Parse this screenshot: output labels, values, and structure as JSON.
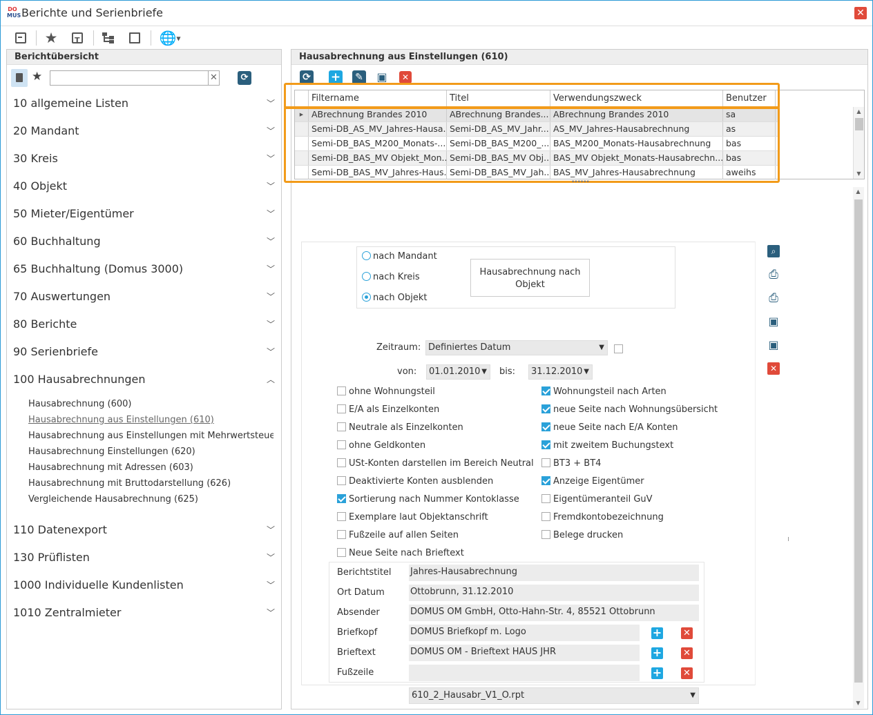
{
  "window": {
    "title": "Berichte und Serienbriefe",
    "logo_top": "DO",
    "logo_bottom": "MUS",
    "close_label": "✕"
  },
  "toolbar": {
    "icons": [
      "import-icon",
      "star-icon",
      "text-template-icon",
      "tree-icon",
      "chart-document-icon",
      "globe-icon"
    ]
  },
  "left": {
    "header": "Berichtübersicht",
    "search_placeholder": "",
    "search_clear": "✕",
    "categories": [
      {
        "label": "10 allgemeine Listen"
      },
      {
        "label": "20 Mandant"
      },
      {
        "label": "30 Kreis"
      },
      {
        "label": "40 Objekt"
      },
      {
        "label": "50 Mieter/Eigentümer"
      },
      {
        "label": "60 Buchhaltung"
      },
      {
        "label": "65 Buchhaltung (Domus 3000)"
      },
      {
        "label": "70 Auswertungen"
      },
      {
        "label": "80 Berichte"
      },
      {
        "label": "90 Serienbriefe"
      },
      {
        "label": "100 Hausabrechnungen"
      },
      {
        "label": "110 Datenexport"
      },
      {
        "label": "130 Prüflisten"
      },
      {
        "label": "1000 Individuelle Kundenlisten"
      },
      {
        "label": "1010 Zentralmieter"
      }
    ],
    "sub_items": [
      {
        "label": "Hausabrechnung (600)"
      },
      {
        "label": "Hausabrechnung aus Einstellungen (610)"
      },
      {
        "label": "Hausabrechnung aus Einstellungen mit Mehrwertsteuer (..."
      },
      {
        "label": "Hausabrechnung Einstellungen (620)"
      },
      {
        "label": "Hausabrechnung mit Adressen (603)"
      },
      {
        "label": "Hausabrechnung mit Bruttodarstellung (626)"
      },
      {
        "label": "Vergleichende Hausabrechnung (625)"
      }
    ]
  },
  "right": {
    "header": "Hausabrechnung aus Einstellungen (610)",
    "grid": {
      "columns": [
        "Filtername",
        "Titel",
        "Verwendungszweck",
        "Benutzer"
      ],
      "rows": [
        [
          "ABrechnung Brandes 2010",
          "ABrechnung Brandes...",
          "ABrechnung Brandes 2010",
          "sa"
        ],
        [
          "Semi-DB_AS_MV_Jahres-Hausa...",
          "Semi-DB_AS_MV_Jahr...",
          "AS_MV_Jahres-Hausabrechnung",
          "as"
        ],
        [
          "Semi-DB_BAS_M200_Monats-...",
          "Semi-DB_BAS_M200_...",
          "BAS_M200_Monats-Hausabrechnung",
          "bas"
        ],
        [
          "Semi-DB_BAS_MV Objekt_Mon...",
          "Semi-DB_BAS_MV Obj...",
          "BAS_MV Objekt_Monats-Hausabrechn...",
          "bas"
        ],
        [
          "Semi-DB_BAS_MV_Jahres-Haus...",
          "Semi-DB_BAS_MV_Jah...",
          "BAS_MV_Jahres-Hausabrechnung",
          "aweihs"
        ]
      ]
    },
    "form": {
      "radios": [
        {
          "label": "nach Mandant",
          "checked": false
        },
        {
          "label": "nach Kreis",
          "checked": false
        },
        {
          "label": "nach Objekt",
          "checked": true
        }
      ],
      "big_button": "Hausabrechnung nach Objekt",
      "zeitraum_label": "Zeitraum:",
      "zeitraum_value": "Definiertes Datum",
      "von_label": "von:",
      "von_value": "01.01.2010",
      "bis_label": "bis:",
      "bis_value": "31.12.2010",
      "checks_left": [
        {
          "label": "ohne Wohnungsteil",
          "checked": false
        },
        {
          "label": "E/A als Einzelkonten",
          "checked": false
        },
        {
          "label": "Neutrale als Einzelkonten",
          "checked": false
        },
        {
          "label": "ohne Geldkonten",
          "checked": false
        },
        {
          "label": "USt-Konten darstellen im Bereich Neutral",
          "checked": false
        },
        {
          "label": "Deaktivierte Konten ausblenden",
          "checked": false
        },
        {
          "label": "Sortierung nach Nummer Kontoklasse",
          "checked": true
        },
        {
          "label": "Exemplare laut Objektanschrift",
          "checked": false
        },
        {
          "label": "Fußzeile auf allen Seiten",
          "checked": false
        },
        {
          "label": "Neue Seite nach Brieftext",
          "checked": false
        }
      ],
      "checks_right": [
        {
          "label": "Wohnungsteil nach Arten",
          "checked": true
        },
        {
          "label": "neue Seite nach Wohnungsübersicht",
          "checked": true
        },
        {
          "label": "neue Seite nach E/A Konten",
          "checked": true
        },
        {
          "label": "mit zweitem Buchungstext",
          "checked": true
        },
        {
          "label": "BT3 + BT4",
          "checked": false
        },
        {
          "label": "Anzeige Eigentümer",
          "checked": true
        },
        {
          "label": "Eigentümeranteil GuV",
          "checked": false
        },
        {
          "label": "Fremdkontobezeichnung",
          "checked": false
        },
        {
          "label": "Belege drucken",
          "checked": false
        }
      ],
      "fields": [
        {
          "label": "Berichtstitel",
          "value": "Jahres-Hausabrechnung"
        },
        {
          "label": "Ort Datum",
          "value": "Ottobrunn, 31.12.2010"
        },
        {
          "label": "Absender",
          "value": "DOMUS OM GmbH, Otto-Hahn-Str. 4, 85521 Ottobrunn"
        },
        {
          "label": "Briefkopf",
          "value": "DOMUS Briefkopf m. Logo"
        },
        {
          "label": "Brieftext",
          "value": "DOMUS OM - Brieftext HAUS JHR"
        },
        {
          "label": "Fußzeile",
          "value": ""
        }
      ],
      "template_value": "610_2_Hausabr_V1_O.rpt"
    }
  },
  "colors": {
    "accent": "#2aa1d9",
    "highlight": "#f29b1a",
    "danger": "#e04a3a"
  }
}
